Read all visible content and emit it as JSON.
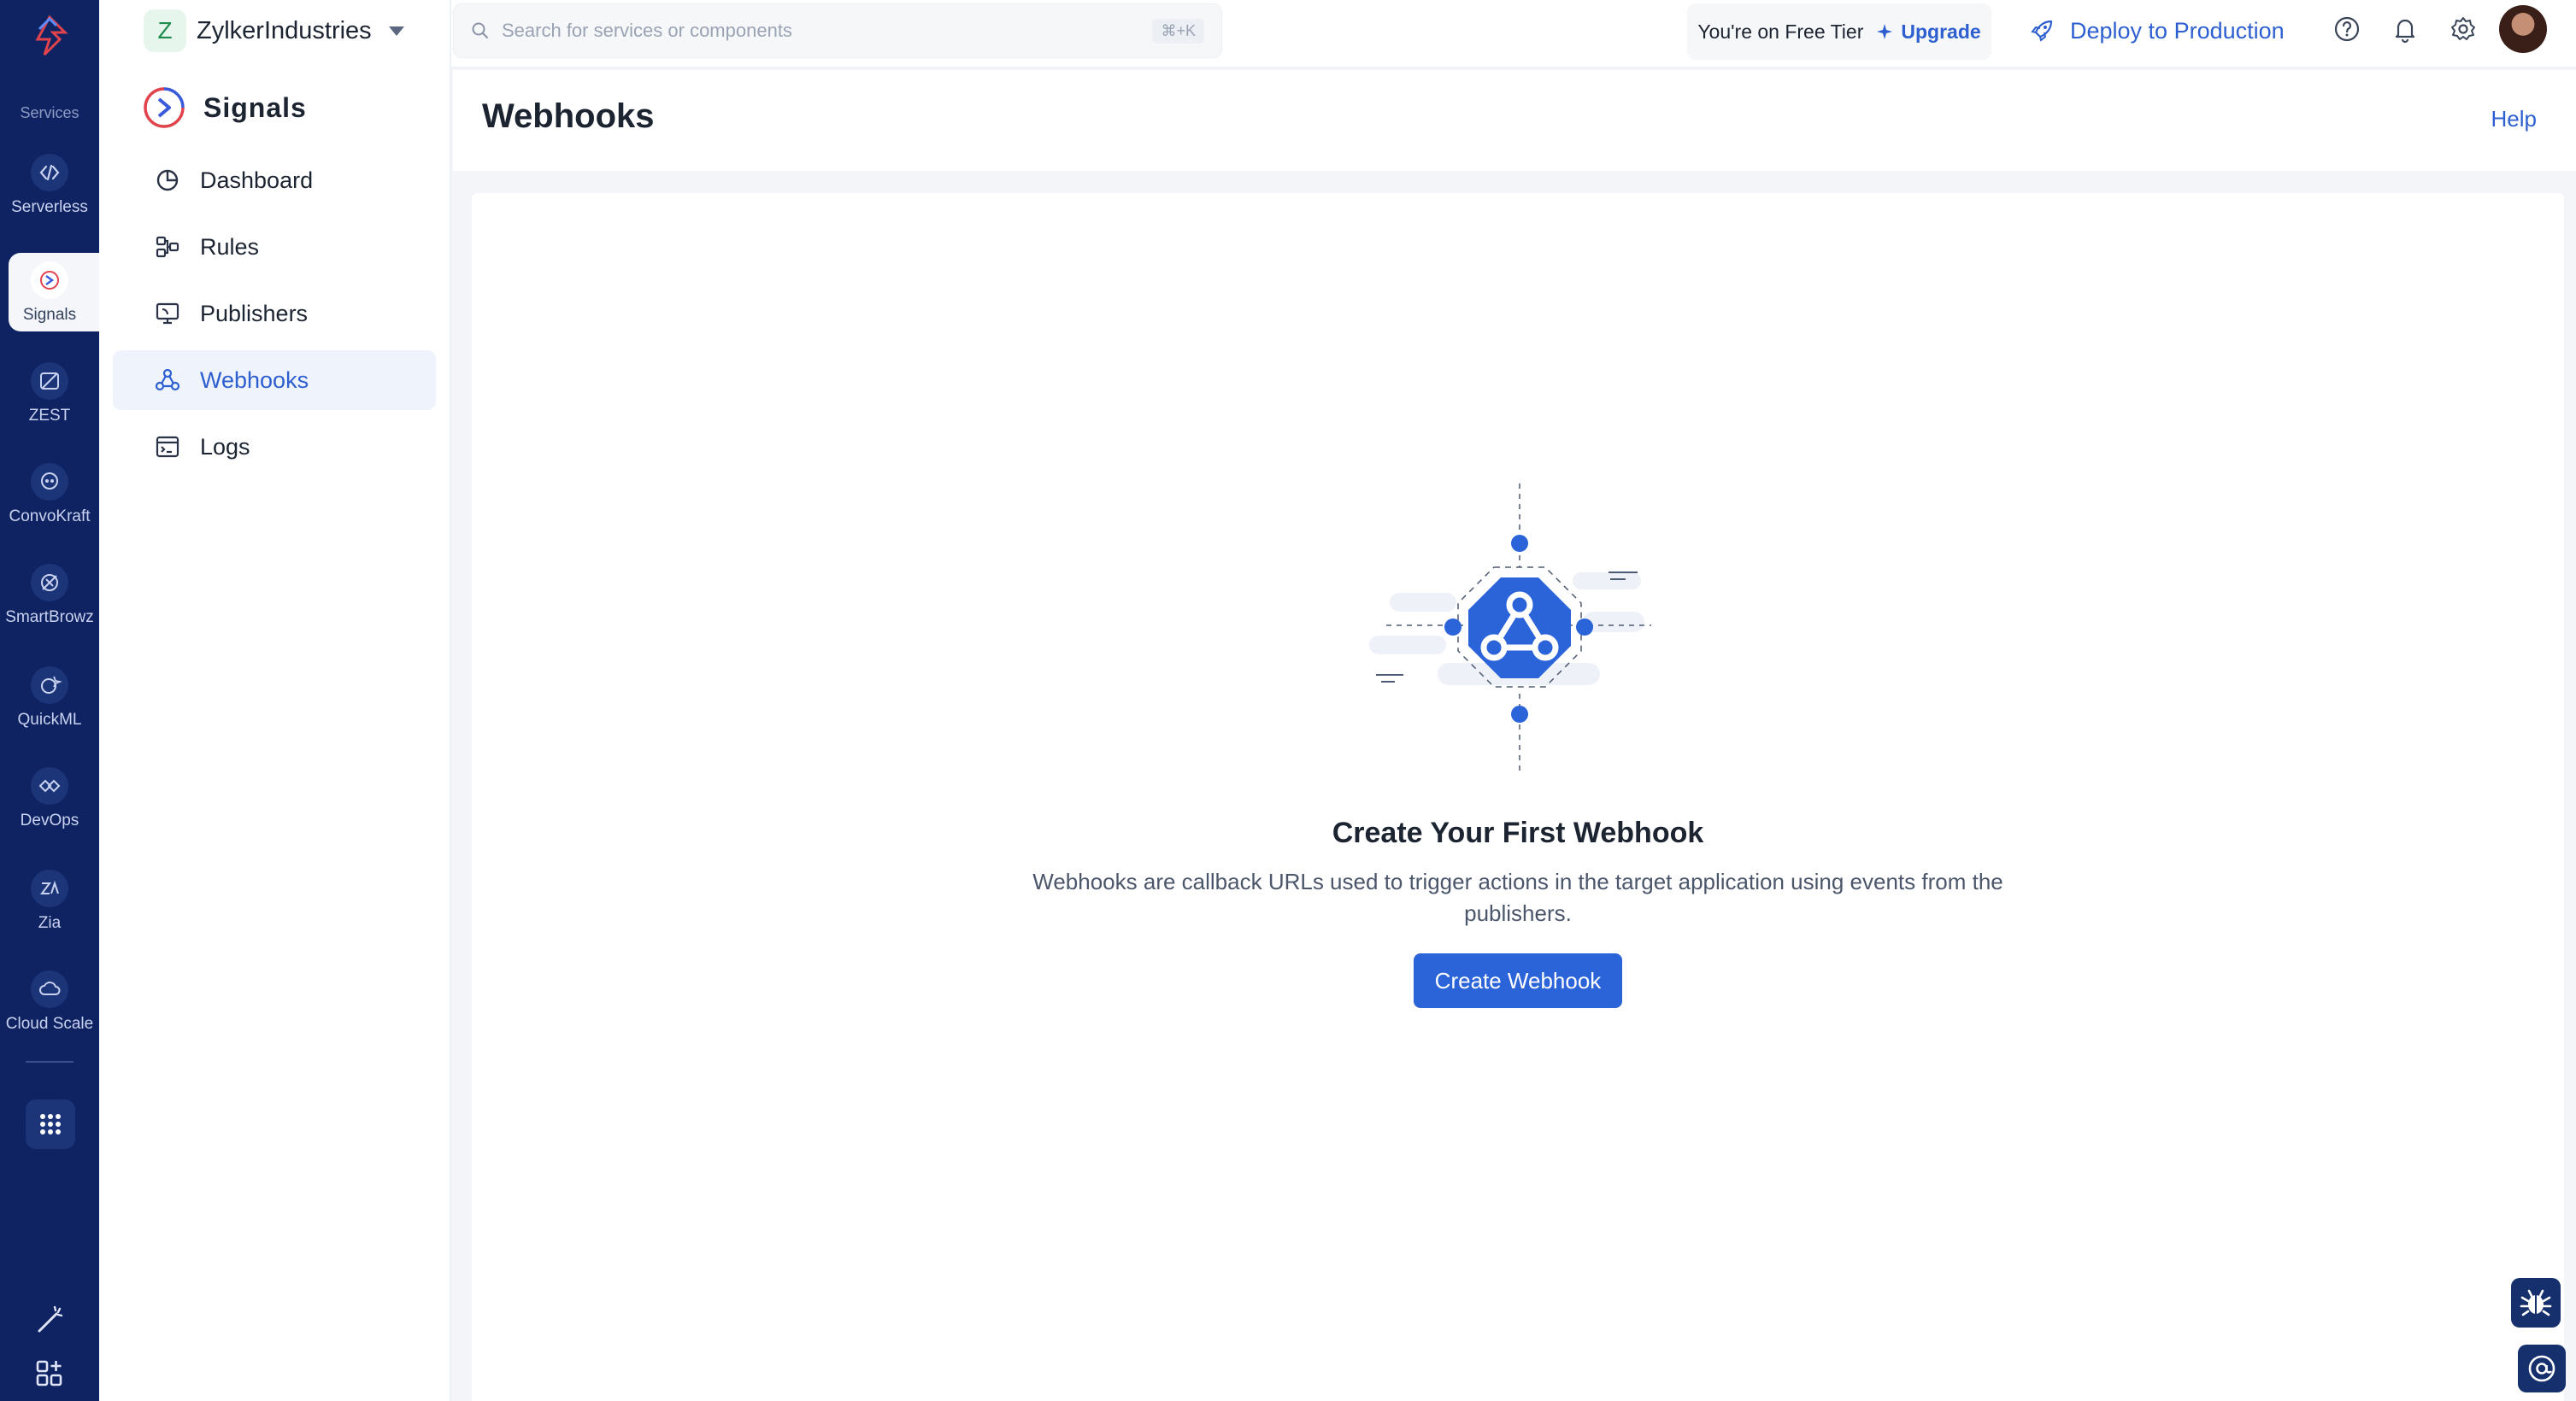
{
  "rail": {
    "section_label": "Services",
    "items": [
      {
        "label": "Serverless",
        "icon": "serverless-icon"
      },
      {
        "label": "Signals",
        "icon": "signals-icon"
      },
      {
        "label": "ZEST",
        "icon": "zest-icon"
      },
      {
        "label": "ConvoKraft",
        "icon": "convokraft-icon"
      },
      {
        "label": "SmartBrowz",
        "icon": "smartbrowz-icon"
      },
      {
        "label": "QuickML",
        "icon": "quickml-icon"
      },
      {
        "label": "DevOps",
        "icon": "devops-icon"
      },
      {
        "label": "Zia",
        "icon": "zia-icon"
      },
      {
        "label": "Cloud Scale",
        "icon": "cloud-scale-icon"
      }
    ],
    "active": "Signals"
  },
  "org": {
    "initial": "Z",
    "name": "ZylkerIndustries"
  },
  "service": {
    "title": "Signals"
  },
  "nav": {
    "items": [
      {
        "label": "Dashboard"
      },
      {
        "label": "Rules"
      },
      {
        "label": "Publishers"
      },
      {
        "label": "Webhooks"
      },
      {
        "label": "Logs"
      }
    ],
    "active": "Webhooks"
  },
  "topbar": {
    "search_placeholder": "Search for services or components",
    "search_shortcut": "⌘+K",
    "tier_text": "You're on Free Tier",
    "upgrade_label": "Upgrade",
    "deploy_label": "Deploy to Production"
  },
  "page": {
    "title": "Webhooks",
    "help_label": "Help"
  },
  "empty_state": {
    "title": "Create Your First Webhook",
    "description": "Webhooks are callback URLs used to trigger actions in the target application using events from the publishers.",
    "button_label": "Create Webhook"
  },
  "colors": {
    "rail_bg": "#0f2362",
    "accent": "#2b63d9",
    "link": "#2d5fd0",
    "active_nav_bg": "#eff3fb"
  }
}
